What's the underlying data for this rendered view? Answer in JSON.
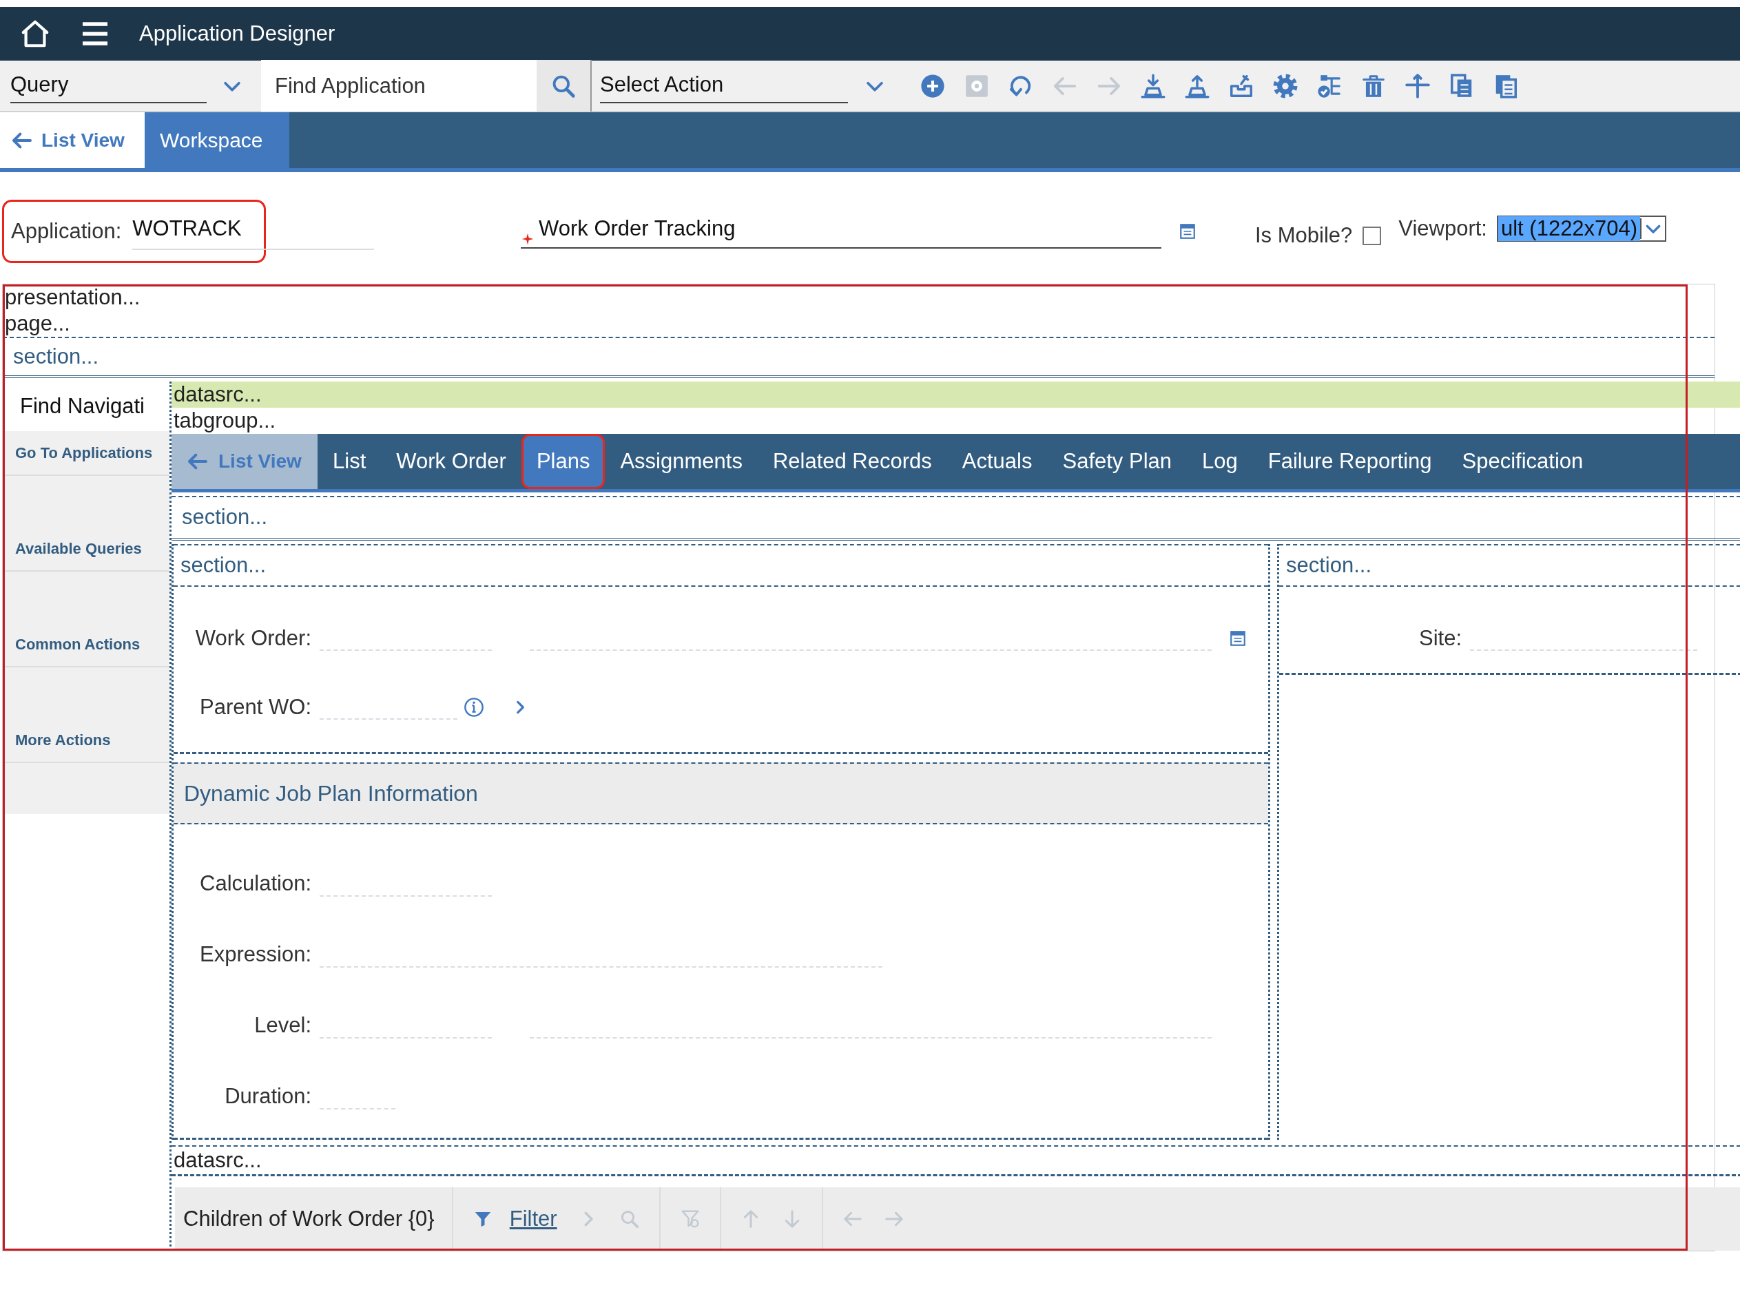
{
  "header": {
    "title": "Application Designer"
  },
  "toolbar": {
    "query": "Query",
    "find_placeholder": "Find Application",
    "select_action": "Select Action",
    "icons": [
      {
        "kind": "add",
        "disabled": false
      },
      {
        "kind": "save",
        "disabled": true
      },
      {
        "kind": "undo",
        "disabled": false
      },
      {
        "kind": "back",
        "disabled": true
      },
      {
        "kind": "forward",
        "disabled": true
      },
      {
        "kind": "import",
        "disabled": false
      },
      {
        "kind": "export",
        "disabled": false
      },
      {
        "kind": "tray",
        "disabled": false
      },
      {
        "kind": "gear",
        "disabled": false
      },
      {
        "kind": "tree",
        "disabled": false
      },
      {
        "kind": "trash",
        "disabled": false
      },
      {
        "kind": "cross",
        "disabled": false
      },
      {
        "kind": "copy",
        "disabled": false
      },
      {
        "kind": "paste",
        "disabled": false
      }
    ]
  },
  "tabs": [
    {
      "label": "List View",
      "kind": "back",
      "selected": false
    },
    {
      "label": "Workspace",
      "kind": "plain",
      "selected": true
    }
  ],
  "application": {
    "label": "Application:",
    "value": "WOTRACK",
    "highlighted": true,
    "description": "Work Order Tracking",
    "required": true,
    "is_mobile_label": "Is Mobile?",
    "is_mobile": false,
    "viewport_label": "Viewport:",
    "viewport_value": "ult (1222x704)"
  },
  "canvas": {
    "highlighted": true,
    "presentation": "presentation...",
    "page": "page...",
    "section": "section...",
    "navigation": {
      "search_placeholder": "Find Navigati",
      "items": [
        "Go To Applications",
        "Available Queries",
        "Common Actions",
        "More Actions"
      ]
    },
    "datasrc": "datasrc...",
    "tabgroup": "tabgroup...",
    "tabs": [
      {
        "label": "List View",
        "kind": "back",
        "selected": false,
        "highlighted": false
      },
      {
        "label": "List",
        "kind": "plain",
        "selected": false,
        "highlighted": false
      },
      {
        "label": "Work Order",
        "kind": "plain",
        "selected": false,
        "highlighted": false
      },
      {
        "label": "Plans",
        "kind": "plain",
        "selected": true,
        "highlighted": true
      },
      {
        "label": "Assignments",
        "kind": "plain",
        "selected": false,
        "highlighted": false
      },
      {
        "label": "Related Records",
        "kind": "plain",
        "selected": false,
        "highlighted": false
      },
      {
        "label": "Actuals",
        "kind": "plain",
        "selected": false,
        "highlighted": false
      },
      {
        "label": "Safety Plan",
        "kind": "plain",
        "selected": false,
        "highlighted": false
      },
      {
        "label": "Log",
        "kind": "plain",
        "selected": false,
        "highlighted": false
      },
      {
        "label": "Failure Reporting",
        "kind": "plain",
        "selected": false,
        "highlighted": false
      },
      {
        "label": "Specification",
        "kind": "plain",
        "selected": false,
        "highlighted": false
      }
    ],
    "tab_section": "section...",
    "left_section": {
      "title": "section...",
      "fields": [
        {
          "label": "Work Order:",
          "kind": "code_description_detail"
        },
        {
          "label": "Parent WO:",
          "kind": "code_info_link"
        }
      ]
    },
    "group_title": "Dynamic Job Plan Information",
    "group_fields": [
      {
        "label": "Calculation:",
        "kind": "short"
      },
      {
        "label": "Expression:",
        "kind": "wide"
      },
      {
        "label": "Level:",
        "kind": "code_description"
      },
      {
        "label": "Duration:",
        "kind": "tiny"
      }
    ],
    "right_section": {
      "title": "section...",
      "fields": [
        {
          "label": "Site:",
          "kind": "site"
        }
      ]
    },
    "datasrc_bottom": "datasrc...",
    "table_toolbar": {
      "title": "Children of Work Order {0}",
      "filter_link": "Filter",
      "tool_groups": [
        [
          {
            "kind": "chevron",
            "disabled": true
          },
          {
            "kind": "search",
            "disabled": true
          }
        ],
        [
          {
            "kind": "clear_filter",
            "disabled": true
          }
        ],
        [
          {
            "kind": "up",
            "disabled": true
          },
          {
            "kind": "down",
            "disabled": true
          }
        ],
        [
          {
            "kind": "left",
            "disabled": true
          },
          {
            "kind": "right",
            "disabled": true
          }
        ]
      ]
    }
  }
}
